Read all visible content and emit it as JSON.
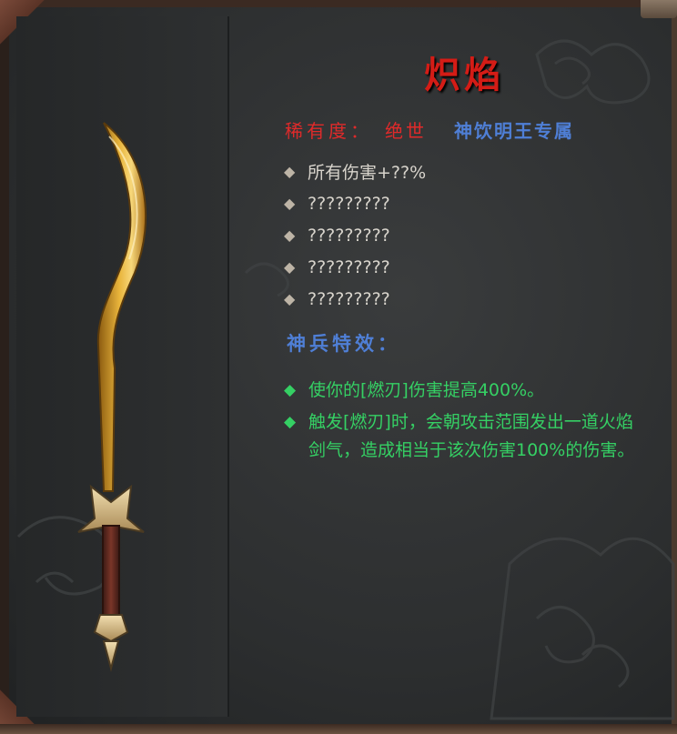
{
  "weapon": {
    "name": "炽焰",
    "rarity_label": "稀有度：",
    "rarity_value": "绝世",
    "exclusive_to": "神饮明王专属",
    "stats": [
      "所有伤害+??%",
      "?????????",
      "?????????",
      "?????????",
      "?????????"
    ],
    "special_effect_title": "神兵特效：",
    "special_effects": [
      "使你的[燃刃]伤害提高400%。",
      "触发[燃刃]时，会朝攻击范围发出一道火焰剑气，造成相当于该次伤害100%的伤害。"
    ],
    "icon": "golden-curved-sword-icon"
  },
  "colors": {
    "title": "#d41c16",
    "rarity": "#e02a2a",
    "exclusive": "#4f7fd6",
    "effects": "#35d064",
    "stats": "#d8d4cc",
    "background": "#2c2e2f"
  }
}
